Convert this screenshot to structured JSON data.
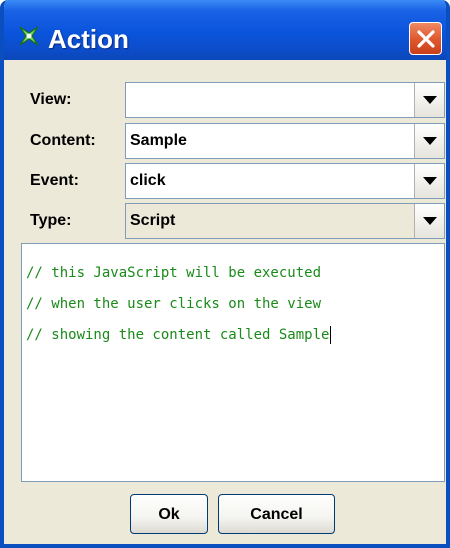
{
  "window": {
    "title": "Action",
    "title_icon": "action-sparkle-icon",
    "close_icon": "close-icon",
    "accent_color": "#0a54dc"
  },
  "form": {
    "view": {
      "label": "View:",
      "value": ""
    },
    "content": {
      "label": "Content:",
      "value": "Sample"
    },
    "event": {
      "label": "Event:",
      "value": "click"
    },
    "type": {
      "label": "Type:",
      "value": "Script"
    }
  },
  "editor": {
    "lines": [
      "// this JavaScript will be executed",
      "// when the user clicks on the view",
      "// showing the content called Sample"
    ],
    "text_color": "#1a8a1a"
  },
  "buttons": {
    "ok_label": "Ok",
    "cancel_label": "Cancel"
  }
}
